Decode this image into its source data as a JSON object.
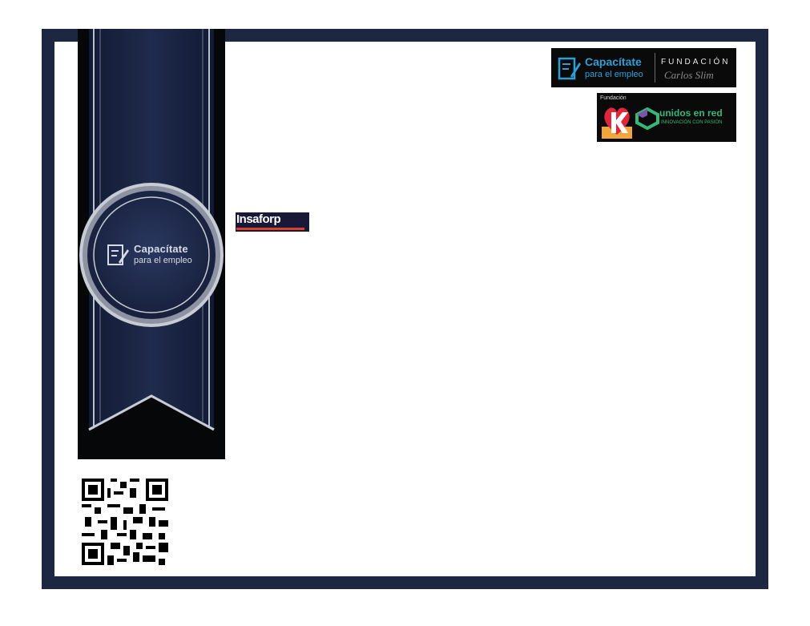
{
  "seal": {
    "line1": "Capacítate",
    "line2": "para el empleo"
  },
  "logos": {
    "capacitate": {
      "line1": "Capacítate",
      "line2": "para el empleo",
      "fundacion": "FUNDACIÓN",
      "signature": "Carlos Slim"
    },
    "unidos": {
      "fundacion": "Fundación",
      "line1": "unidos en red",
      "line2": "INNOVACIÓN CON PASIÓN"
    },
    "insaforp": {
      "name": "Insaforp"
    }
  },
  "colors": {
    "frame": "#1e2741",
    "ribbon": "#1f2b4d",
    "accent_blue": "#2e9fd6",
    "accent_green": "#38b77a",
    "accent_red": "#d9432b"
  },
  "icons": [
    "edit-checklist-icon",
    "qr-code-icon"
  ]
}
